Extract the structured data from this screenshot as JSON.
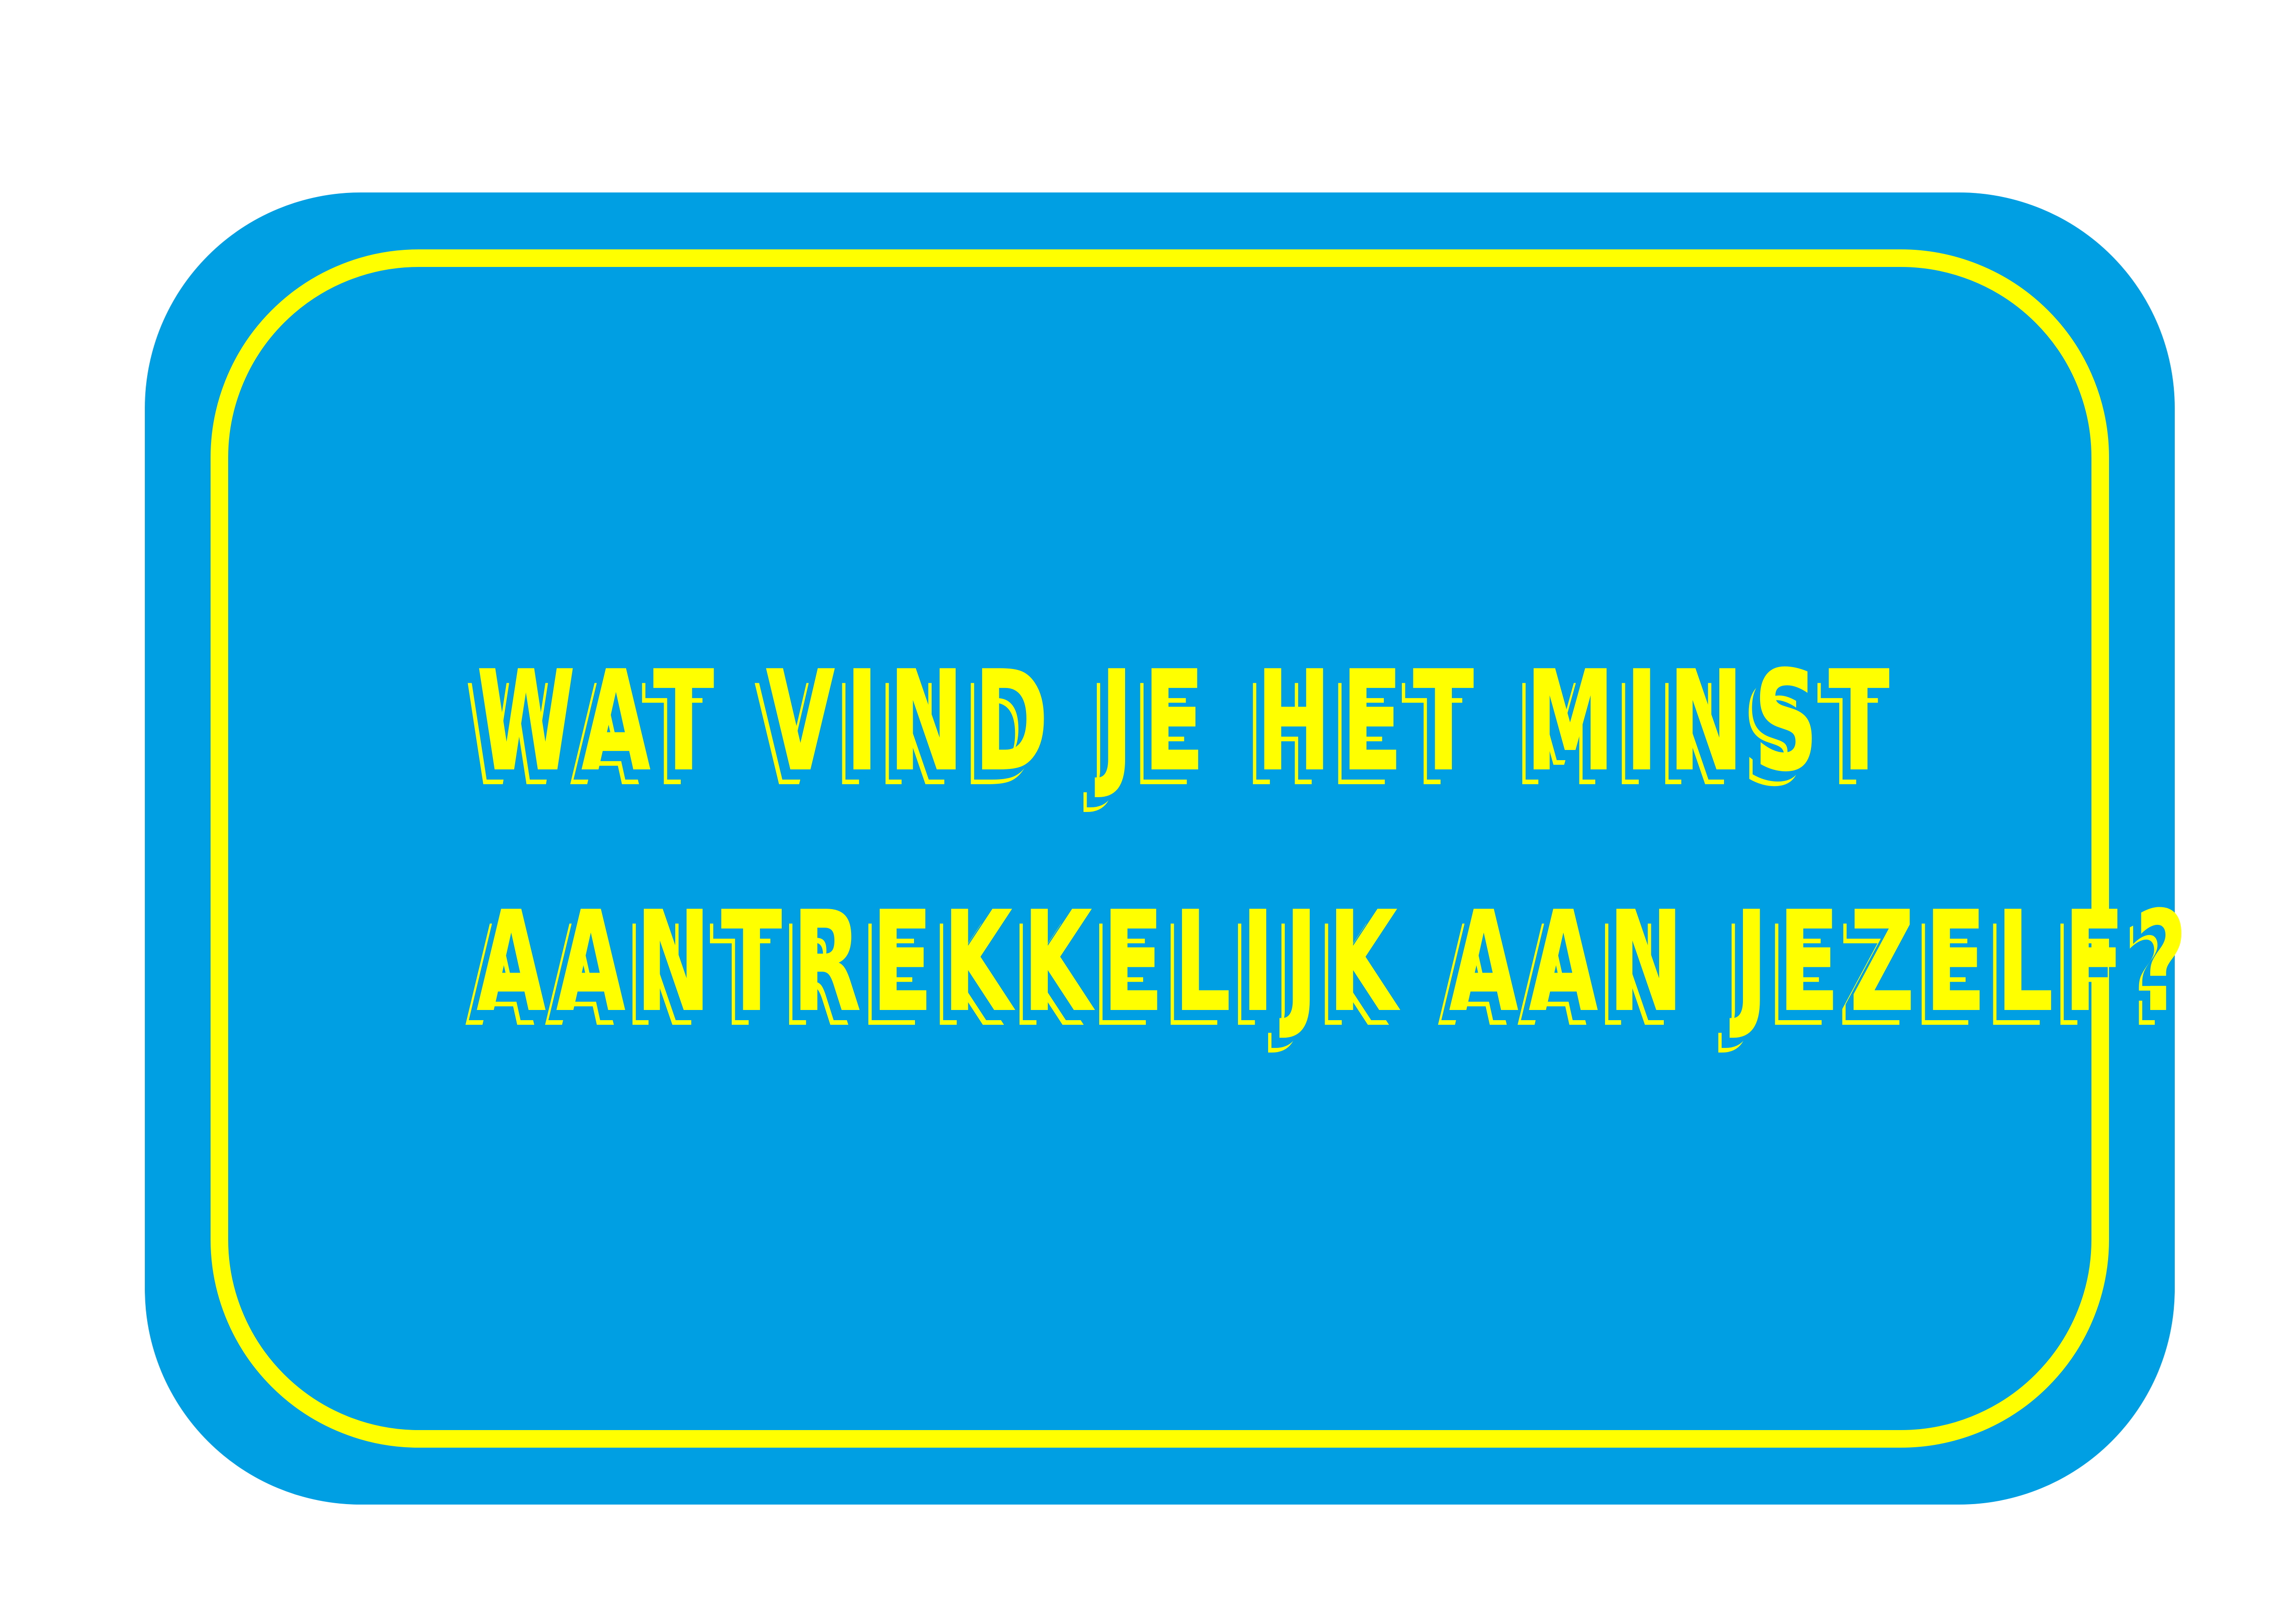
{
  "card": {
    "line1": "WAT VIND JE HET MINST",
    "line2": "AANTREKKELIJK AAN JEZELF?"
  },
  "colors": {
    "background": "#ffffff",
    "card": "#009fe3",
    "accent": "#ffff00"
  }
}
